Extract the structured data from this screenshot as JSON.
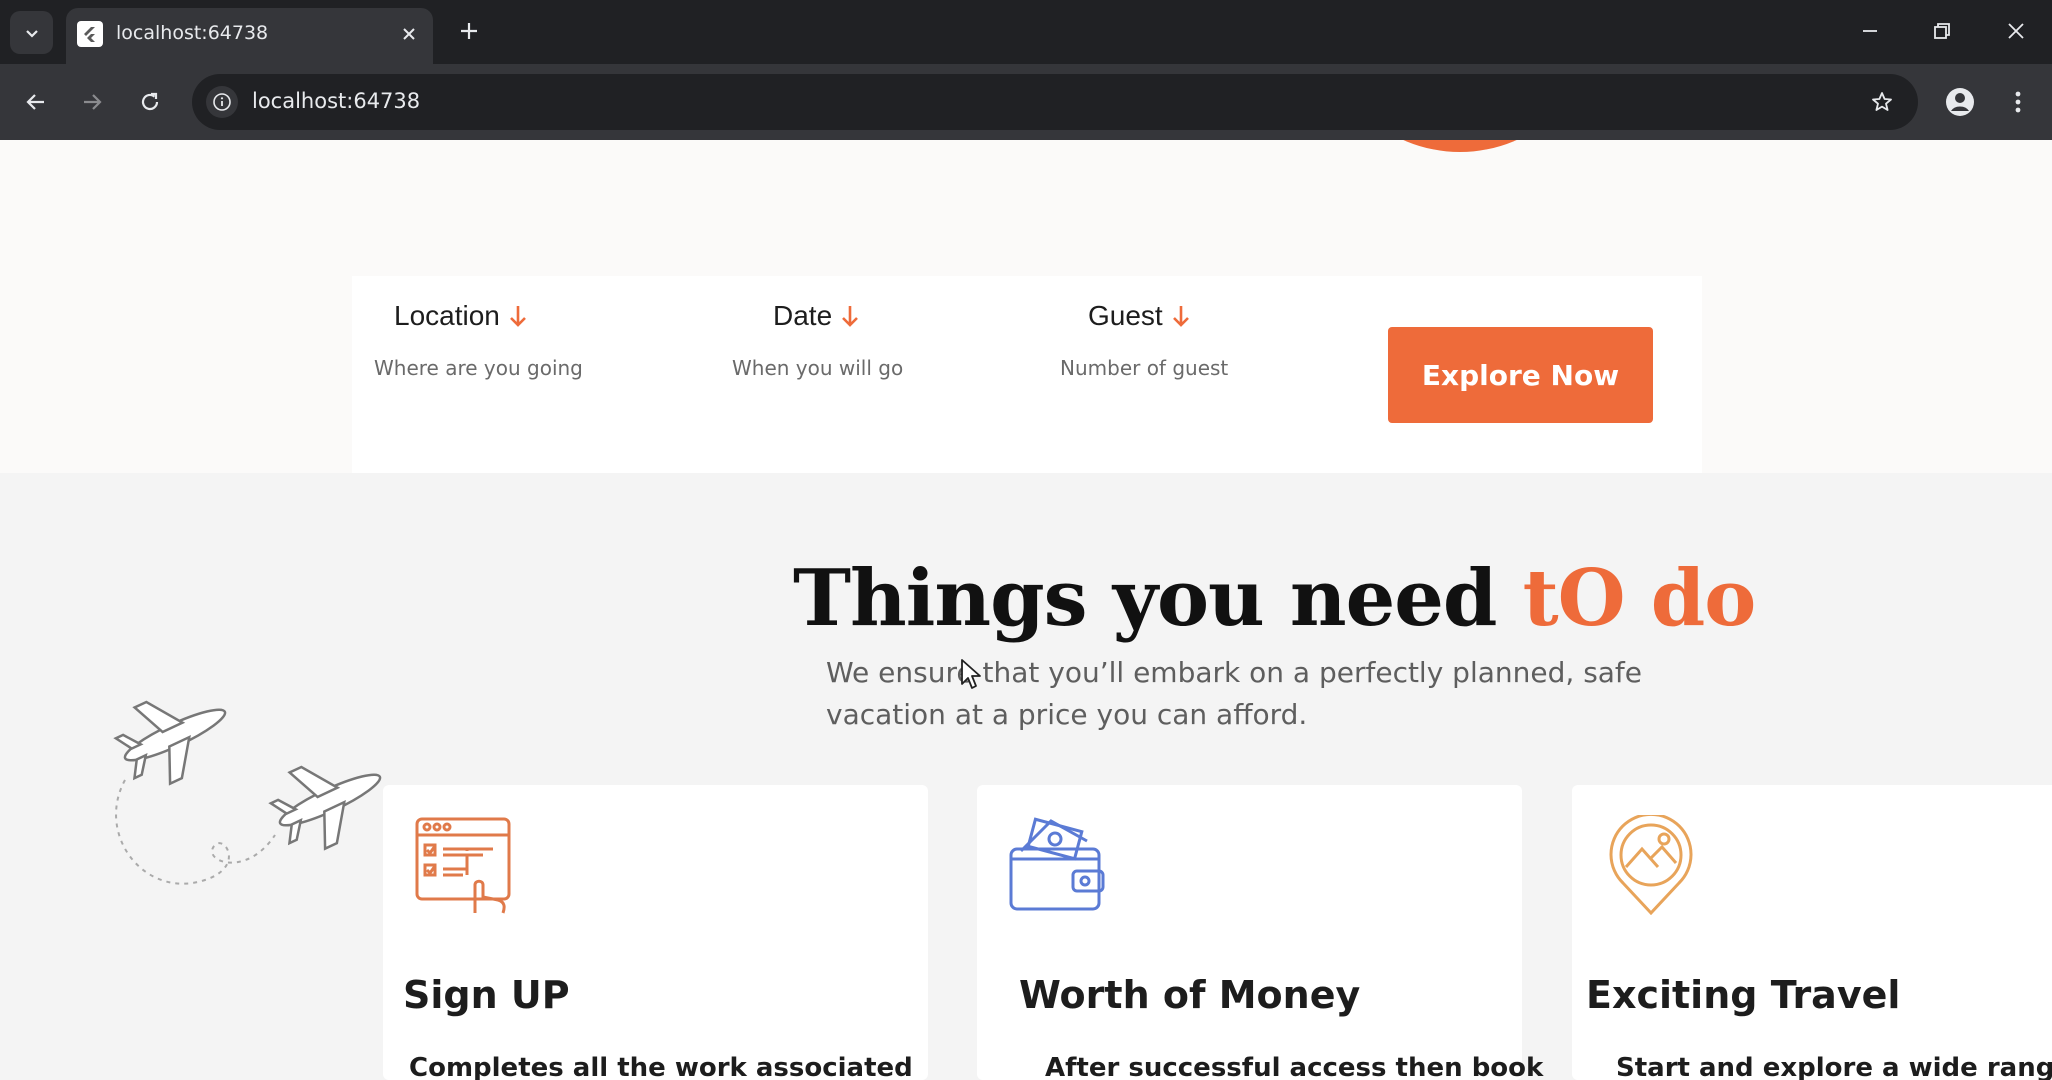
{
  "browser": {
    "tab_title": "localhost:64738",
    "url": "localhost:64738"
  },
  "search": {
    "location": {
      "label": "Location",
      "hint": "Where are you going"
    },
    "date": {
      "label": "Date",
      "hint": "When you will go"
    },
    "guest": {
      "label": "Guest",
      "hint": "Number of guest"
    },
    "button": "Explore Now"
  },
  "section": {
    "heading_main": "Things you need ",
    "heading_accent": "tO do",
    "subtext": "We ensure that you’ll embark on a perfectly planned, safe vacation at a price you can afford."
  },
  "cards": [
    {
      "title": "Sign UP",
      "text": "Completes all the work associated",
      "icon": "checklist-click-icon",
      "icon_color": "#e07a4a"
    },
    {
      "title": "Worth of Money",
      "text": "After successful access then book",
      "icon": "wallet-icon",
      "icon_color": "#5b7bd5"
    },
    {
      "title": "Exciting Travel",
      "text": "Start and explore a wide range of",
      "icon": "location-pin-icon",
      "icon_color": "#e8a45a"
    }
  ],
  "colors": {
    "accent": "#ee6b3a",
    "chrome_dark": "#202124",
    "chrome": "#35363a"
  }
}
